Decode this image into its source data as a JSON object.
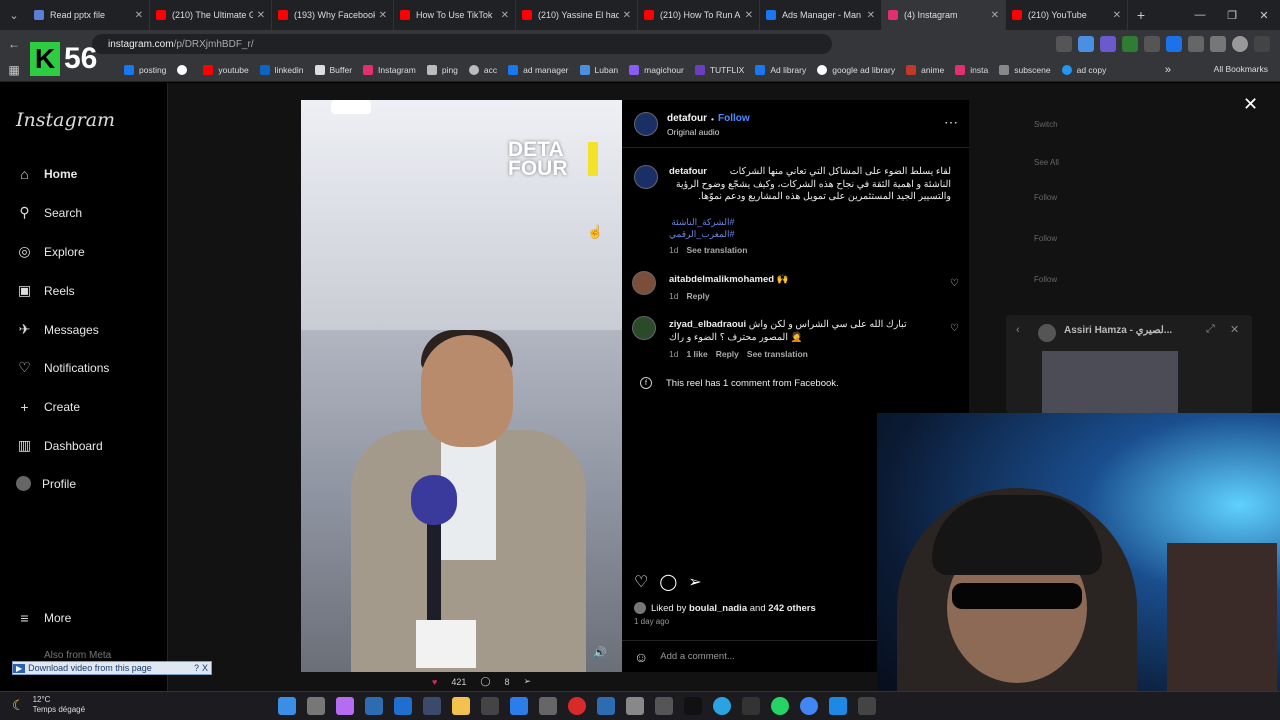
{
  "browser": {
    "tabs": [
      {
        "label": "Read pptx file",
        "color": "#5b7fd6"
      },
      {
        "label": "(210) The Ultimate G",
        "color": "#ff0000"
      },
      {
        "label": "(193) Why Facebook",
        "color": "#ff0000"
      },
      {
        "label": "How To Use TikTok",
        "color": "#ff0000"
      },
      {
        "label": "(210) Yassine El hadi",
        "color": "#ff0000"
      },
      {
        "label": "(210) How To Run A",
        "color": "#ff0000"
      },
      {
        "label": "Ads Manager - Man",
        "color": "#1877f2"
      },
      {
        "label": "(4) Instagram",
        "color": "#e1306c"
      },
      {
        "label": "(210) YouTube",
        "color": "#ff0000"
      }
    ],
    "url_host": "instagram.com",
    "url_path": "/p/DRXjmhBDF_r/",
    "bookmarks": [
      "posting",
      "youtube",
      "linkedin",
      "Buffer",
      "Instagram",
      "ping",
      "acc",
      "ad manager",
      "Luban",
      "magichour",
      "TUTFLIX",
      "Ad library",
      "google ad library",
      "anime",
      "insta",
      "subscene",
      "ad copy"
    ],
    "all_bookmarks": "All Bookmarks"
  },
  "overlay_badge": {
    "letter": "K",
    "number": "56"
  },
  "instagram": {
    "logo": "Instagram",
    "nav": [
      "Home",
      "Search",
      "Explore",
      "Reels",
      "Messages",
      "Notifications",
      "Create",
      "Dashboard",
      "Profile"
    ],
    "more": "More",
    "also_from_meta": "Also from Meta",
    "right_muted": [
      "Switch",
      "See All",
      "Follow",
      "Follow",
      "Follow"
    ]
  },
  "post": {
    "video_watermark_line1": "DETA",
    "video_watermark_line2": "FOUR",
    "username": "detafour",
    "follow": "Follow",
    "audio": "Original audio",
    "caption": "لقاء يسلط الضوء على المشاكل التي تعاني منها الشركات الناشئة و اهمية الثقة في نجاح هذه الشركات، وكيف يشجّع وضوح الرؤية والتسيير الجيد المستثمرين على تمويل هذه المشاريع ودعم نموّها.",
    "hashtags": [
      "#الشركة_الناشئة",
      "#المغرب_الرقمي"
    ],
    "caption_age": "1d",
    "see_translation": "See translation",
    "comments": [
      {
        "user": "aitabdelmalikmohamed",
        "text": "🙌",
        "age": "1d",
        "likes": "",
        "reply": "Reply",
        "translate": ""
      },
      {
        "user": "ziyad_elbadraoui",
        "text": "تبارك الله على سي الشراس و لكن واش المصور محترف ؟ الضوء و راك 🤦",
        "age": "1d",
        "likes": "1 like",
        "reply": "Reply",
        "translate": "See translation"
      }
    ],
    "facebook_note": "This reel has 1 comment from Facebook.",
    "liked_by_prefix": "Liked by",
    "liked_by_user": "boulal_nadia",
    "liked_by_and": "and",
    "liked_by_others": "242 others",
    "posted_ago": "1 day ago",
    "add_comment": "Add a comment..."
  },
  "miniplayer": {
    "title": "Assiri Hamza - لصيري..."
  },
  "bottom_strip": {
    "likes": "421",
    "comments": "8"
  },
  "download_bar": {
    "label": "Download video from this page",
    "help": "?",
    "close": "X"
  },
  "taskbar": {
    "temp": "12°C",
    "weather": "Temps dégagé"
  }
}
